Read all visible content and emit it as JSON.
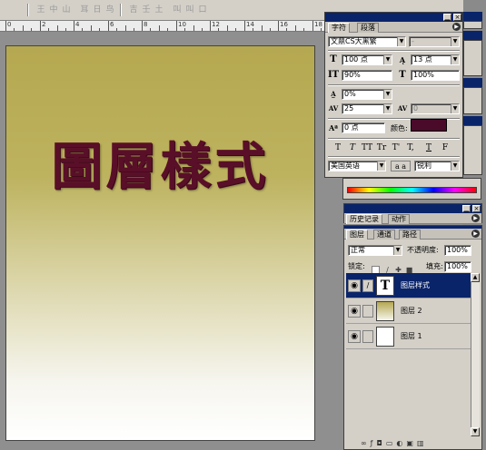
{
  "options_bar": {
    "glyphs": [
      "王",
      "中",
      "山",
      "耳",
      "日",
      "鸟",
      "吉",
      "壬",
      "土",
      "叫",
      "叫",
      "口"
    ]
  },
  "ruler": {
    "labels": [
      "0",
      "2",
      "4",
      "6",
      "8",
      "10",
      "12",
      "14",
      "16",
      "18"
    ]
  },
  "canvas": {
    "text": "圖層樣式",
    "text_color": "#5a0f28",
    "gradient_top": "#b5a851",
    "gradient_bottom": "#ffffff"
  },
  "character_panel": {
    "tabs": [
      "字符",
      "段落"
    ],
    "font_family": "文鼎CS大黑繁",
    "font_style": "-",
    "font_size": "100 点",
    "leading": "13 点",
    "vertical_scale": "90%",
    "horizontal_scale": "100%",
    "kerning_ratio": "0%",
    "tracking": "25",
    "kerning": "0",
    "baseline_shift": "0 点",
    "color_label": "颜色:",
    "text_color": "#4a0a2a",
    "style_buttons": [
      "T",
      "T",
      "TT",
      "Tr",
      "T'",
      "T,",
      "T",
      "F"
    ],
    "language": "美国英语",
    "aa_icon": "a a",
    "antialias": "锐利"
  },
  "history_panel": {
    "tabs": [
      "历史记录",
      "动作"
    ]
  },
  "layers_panel": {
    "tabs": [
      "图层",
      "通道",
      "路径"
    ],
    "blend_mode": "正常",
    "opacity_label": "不透明度:",
    "opacity": "100%",
    "lock_label": "锁定:",
    "fill_label": "填充:",
    "fill": "100%",
    "layers": [
      {
        "name": "图层样式",
        "thumb": "T",
        "selected": true
      },
      {
        "name": "图层 2",
        "thumb": "",
        "selected": false
      },
      {
        "name": "图层 1",
        "thumb": "",
        "selected": false
      }
    ]
  }
}
